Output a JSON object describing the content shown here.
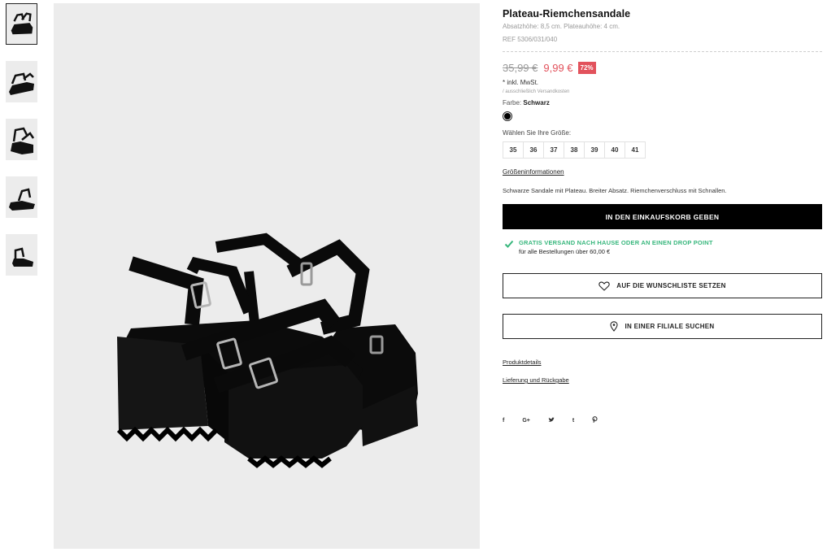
{
  "product": {
    "title": "Plateau-Riemchensandale",
    "subtitle": "Absatzhöhe: 8,5 cm. Plateauhöhe: 4 cm.",
    "ref": "REF 5306/031/040",
    "price_old": "35,99 €",
    "price_new": "9,99 €",
    "discount": "72%",
    "tax_note": "* inkl. MwSt.",
    "shipping_note": "/ ausschließlich Versandkosten",
    "color_label": "Farbe:",
    "color_value": "Schwarz",
    "color_swatch": "#000000",
    "size_label": "Wählen Sie Ihre Größe:",
    "sizes": [
      "35",
      "36",
      "37",
      "38",
      "39",
      "40",
      "41"
    ],
    "size_info_link": "Größeninformationen",
    "description": "Schwarze Sandale mit Plateau. Breiter Absatz. Riemchenverschluss mit Schnallen."
  },
  "actions": {
    "add_to_cart": "IN DEN EINKAUFSKORB GEBEN",
    "wishlist": "AUF DIE WUNSCHLISTE SETZEN",
    "find_store": "IN EINER FILIALE SUCHEN"
  },
  "shipping": {
    "title": "GRATIS VERSAND NACH HAUSE ODER AN EINEN DROP POINT",
    "subtitle": "für alle Bestellungen über 60,00 €",
    "accent": "#38b77d"
  },
  "links": {
    "details": "Produktdetails",
    "delivery": "Lieferung und Rückgabe"
  },
  "social": [
    "f",
    "G+",
    "twitter-icon",
    "t",
    "pinterest-icon"
  ],
  "colors": {
    "sale": "#e2525c",
    "button_dark": "#000000",
    "image_bg": "#ececec"
  }
}
